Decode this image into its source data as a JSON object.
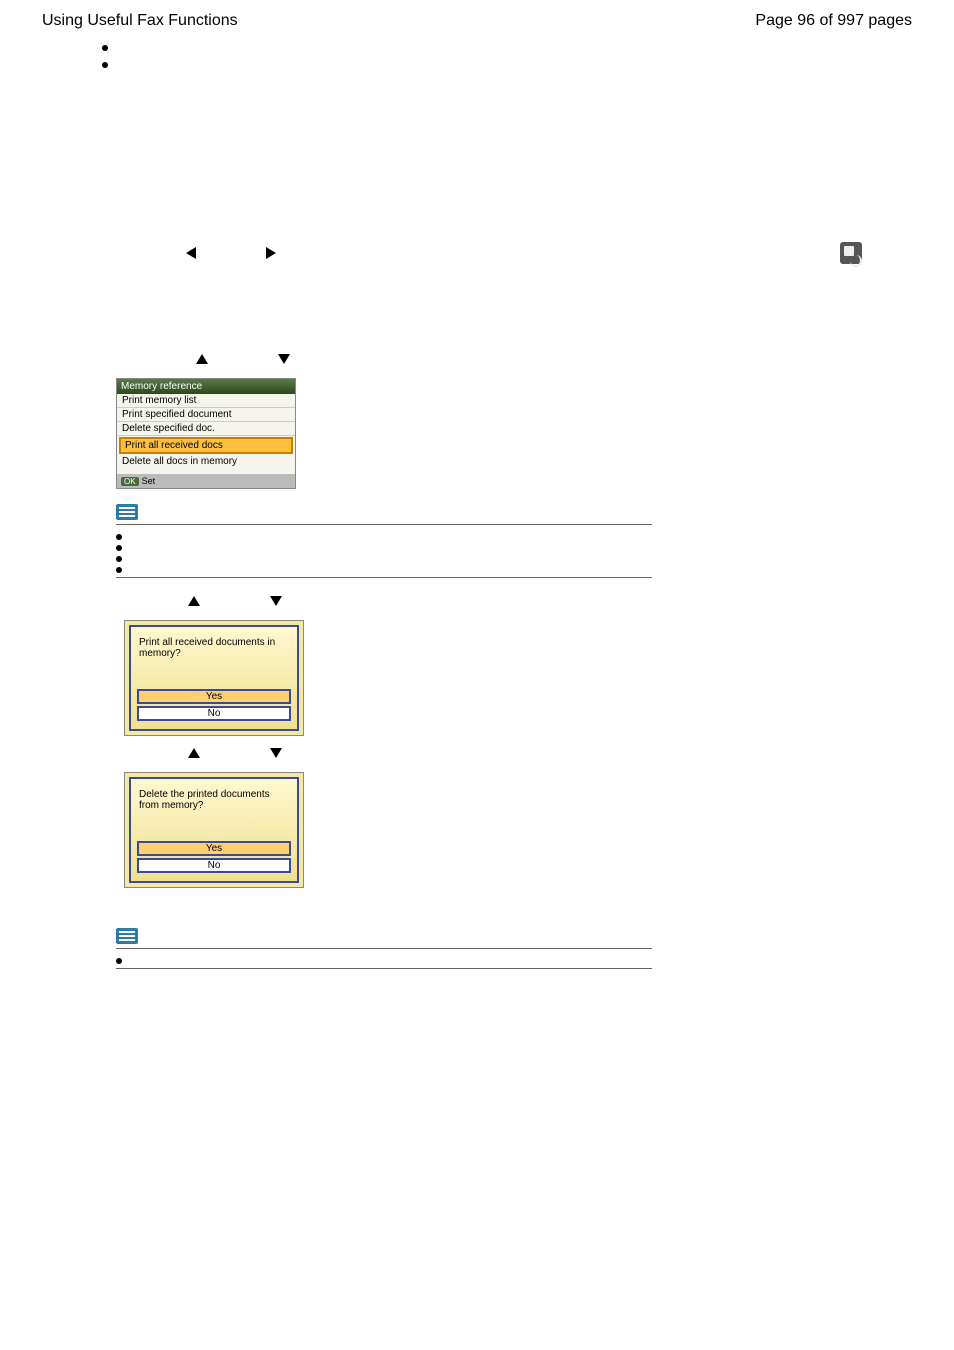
{
  "header": {
    "title": "Using Useful Fax Functions",
    "page_indicator": "Page 96 of 997 pages"
  },
  "top_bullets": [
    "",
    ""
  ],
  "section_heading": "",
  "steps": {
    "s2_prefix": "",
    "s2_suffix": "",
    "s3_text": "",
    "s4_prefix": "",
    "s4_suffix": ""
  },
  "menu_figure": {
    "title": "Memory reference",
    "items": [
      "Print memory list",
      "Print specified document",
      "Delete specified doc.",
      "Print all received docs",
      "Delete all docs in memory"
    ],
    "footer_ok": "OK",
    "footer_set": "Set"
  },
  "note1": {
    "label": "",
    "bullets": [
      "",
      "",
      "",
      ""
    ]
  },
  "step5_prefix": "",
  "step5_suffix": "",
  "dialog1": {
    "text": "Print all received documents in memory?",
    "yes": "Yes",
    "no": "No"
  },
  "step6_prefix": "",
  "step6_suffix": "",
  "dialog2": {
    "text": "Delete the printed documents from memory?",
    "yes": "Yes",
    "no": "No"
  },
  "note2": {
    "label": "",
    "bullets": [
      ""
    ]
  }
}
